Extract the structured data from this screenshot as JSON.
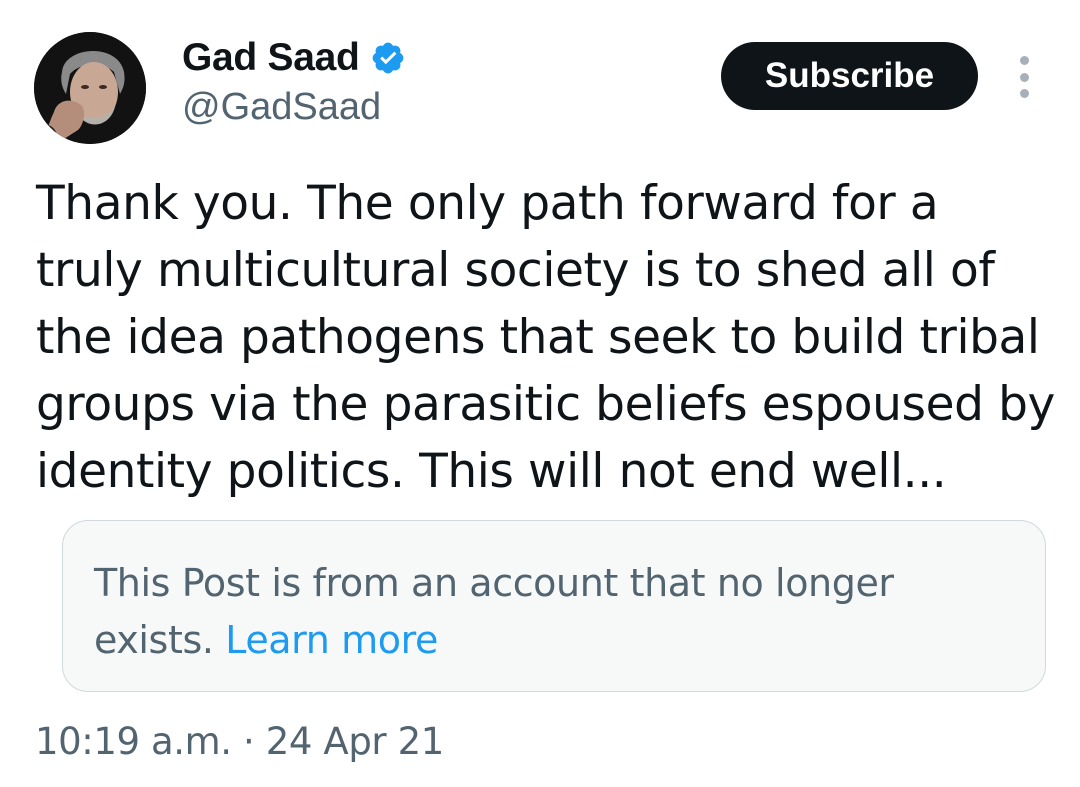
{
  "author": {
    "display_name": "Gad Saad",
    "handle": "@GadSaad",
    "verified": true,
    "verified_color": "#1d9bf0"
  },
  "actions": {
    "subscribe_label": "Subscribe",
    "more_icon": "more-vertical-icon"
  },
  "post": {
    "text": "Thank you. The only path forward for a truly multicultural society is to shed all of the idea pathogens that seek to build tribal groups via the parasitic beliefs espoused by identity politics.  This will not end well..."
  },
  "quoted_notice": {
    "text": "This Post is from an account that no longer exists.",
    "link_label": "Learn more"
  },
  "meta": {
    "time": "10:19 a.m.",
    "separator": "·",
    "date": "24 Apr 21"
  },
  "colors": {
    "text_primary": "#0f1419",
    "text_secondary": "#536471",
    "link": "#1d9bf0",
    "button_bg": "#0f1419"
  }
}
